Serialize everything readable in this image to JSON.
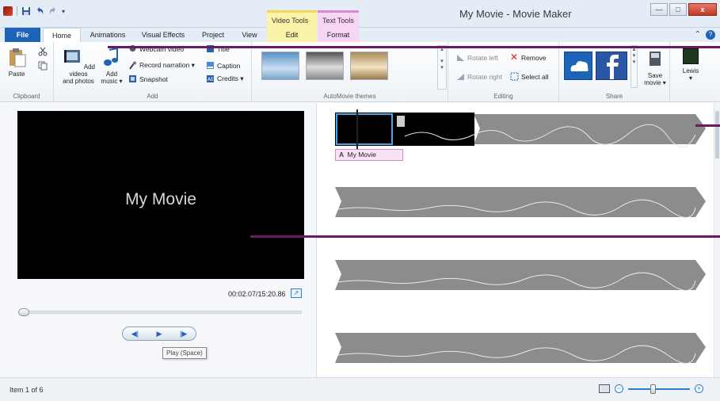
{
  "window": {
    "title": "My Movie - Movie Maker",
    "context_tabs": [
      "Video Tools",
      "Text Tools"
    ]
  },
  "tabs": {
    "file": "File",
    "home": "Home",
    "animations": "Animations",
    "visual_effects": "Visual Effects",
    "project": "Project",
    "view": "View",
    "edit": "Edit",
    "format": "Format"
  },
  "ribbon": {
    "clipboard": {
      "paste": "Paste",
      "group_label": "Clipboard"
    },
    "add": {
      "add_videos_line1": "Add videos",
      "add_videos_line2": "and photos",
      "add_music_line1": "Add",
      "add_music_line2": "music ▾",
      "webcam": "Webcam video",
      "record_narration": "Record narration ▾",
      "snapshot": "Snapshot",
      "title": "Title",
      "caption": "Caption",
      "credits": "Credits ▾",
      "group_label": "Add"
    },
    "themes": {
      "group_label": "AutoMovie themes"
    },
    "editing": {
      "rotate_left": "Rotate left",
      "rotate_right": "Rotate right",
      "remove": "Remove",
      "select_all": "Select all",
      "group_label": "Editing"
    },
    "share": {
      "save_movie_line1": "Save",
      "save_movie_line2": "movie ▾",
      "group_label": "Share"
    },
    "user": {
      "name": "Lewis"
    }
  },
  "preview": {
    "title_text": "My Movie",
    "timecode": "00:02.07/15:20.86",
    "tooltip": "Play (Space)"
  },
  "storyboard": {
    "caption_text": "My Movie",
    "caption_prefix": "A"
  },
  "status": {
    "item_text": "Item 1 of 6"
  },
  "colors": {
    "file_tab": "#1d64b8",
    "video_tools": "#fbf3a7",
    "text_tools": "#f6d6f4",
    "annotation_line": "#6a1a62",
    "waveform": "#8c8c8c"
  }
}
